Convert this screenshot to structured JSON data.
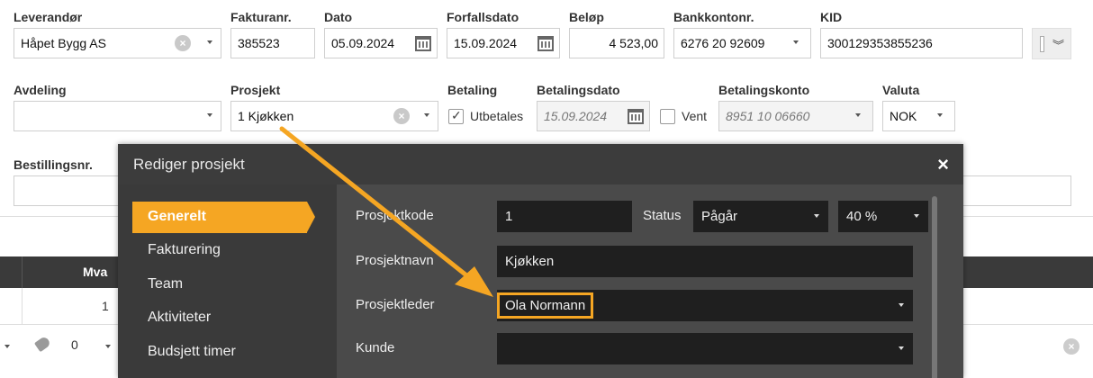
{
  "invoice": {
    "supplier": {
      "label": "Leverandør",
      "value": "Håpet Bygg AS"
    },
    "invoice_no": {
      "label": "Fakturanr.",
      "value": "385523"
    },
    "date": {
      "label": "Dato",
      "value": "05.09.2024"
    },
    "due_date": {
      "label": "Forfallsdato",
      "value": "15.09.2024"
    },
    "amount": {
      "label": "Beløp",
      "value": "4 523,00"
    },
    "bank_account": {
      "label": "Bankkontonr.",
      "value": "6276 20 92609"
    },
    "kid": {
      "label": "KID",
      "value": "300129353855236"
    },
    "department": {
      "label": "Avdeling",
      "value": ""
    },
    "project": {
      "label": "Prosjekt",
      "value": "1 Kjøkken"
    },
    "payment": {
      "label": "Betaling",
      "checkbox_label": "Utbetales",
      "checked": true
    },
    "payment_date": {
      "label": "Betalingsdato",
      "value": "15.09.2024"
    },
    "wait": {
      "label": "Vent",
      "checked": false
    },
    "payment_account": {
      "label": "Betalingskonto",
      "value": "8951 10 06660"
    },
    "currency": {
      "label": "Valuta",
      "value": "NOK"
    },
    "order_no": {
      "label": "Bestillingsnr.",
      "value": ""
    }
  },
  "table": {
    "header_mva": "Mva",
    "row1_mva": "1",
    "row2_value": "0"
  },
  "modal": {
    "title": "Rediger prosjekt",
    "close": "×",
    "nav": [
      "Generelt",
      "Fakturering",
      "Team",
      "Aktiviteter",
      "Budsjett timer"
    ],
    "active_nav": "Generelt",
    "fields": {
      "project_code": {
        "label": "Prosjektkode",
        "value": "1"
      },
      "status": {
        "label": "Status",
        "value": "Pågår"
      },
      "progress": {
        "value": "40 %"
      },
      "project_name": {
        "label": "Prosjektnavn",
        "value": "Kjøkken"
      },
      "project_lead": {
        "label": "Prosjektleder",
        "value": "Ola Normann"
      },
      "customer": {
        "label": "Kunde",
        "value": ""
      }
    }
  },
  "colors": {
    "accent": "#f5a623",
    "modal_bg": "#2b2b2b",
    "table_header": "#3a3a3a"
  }
}
